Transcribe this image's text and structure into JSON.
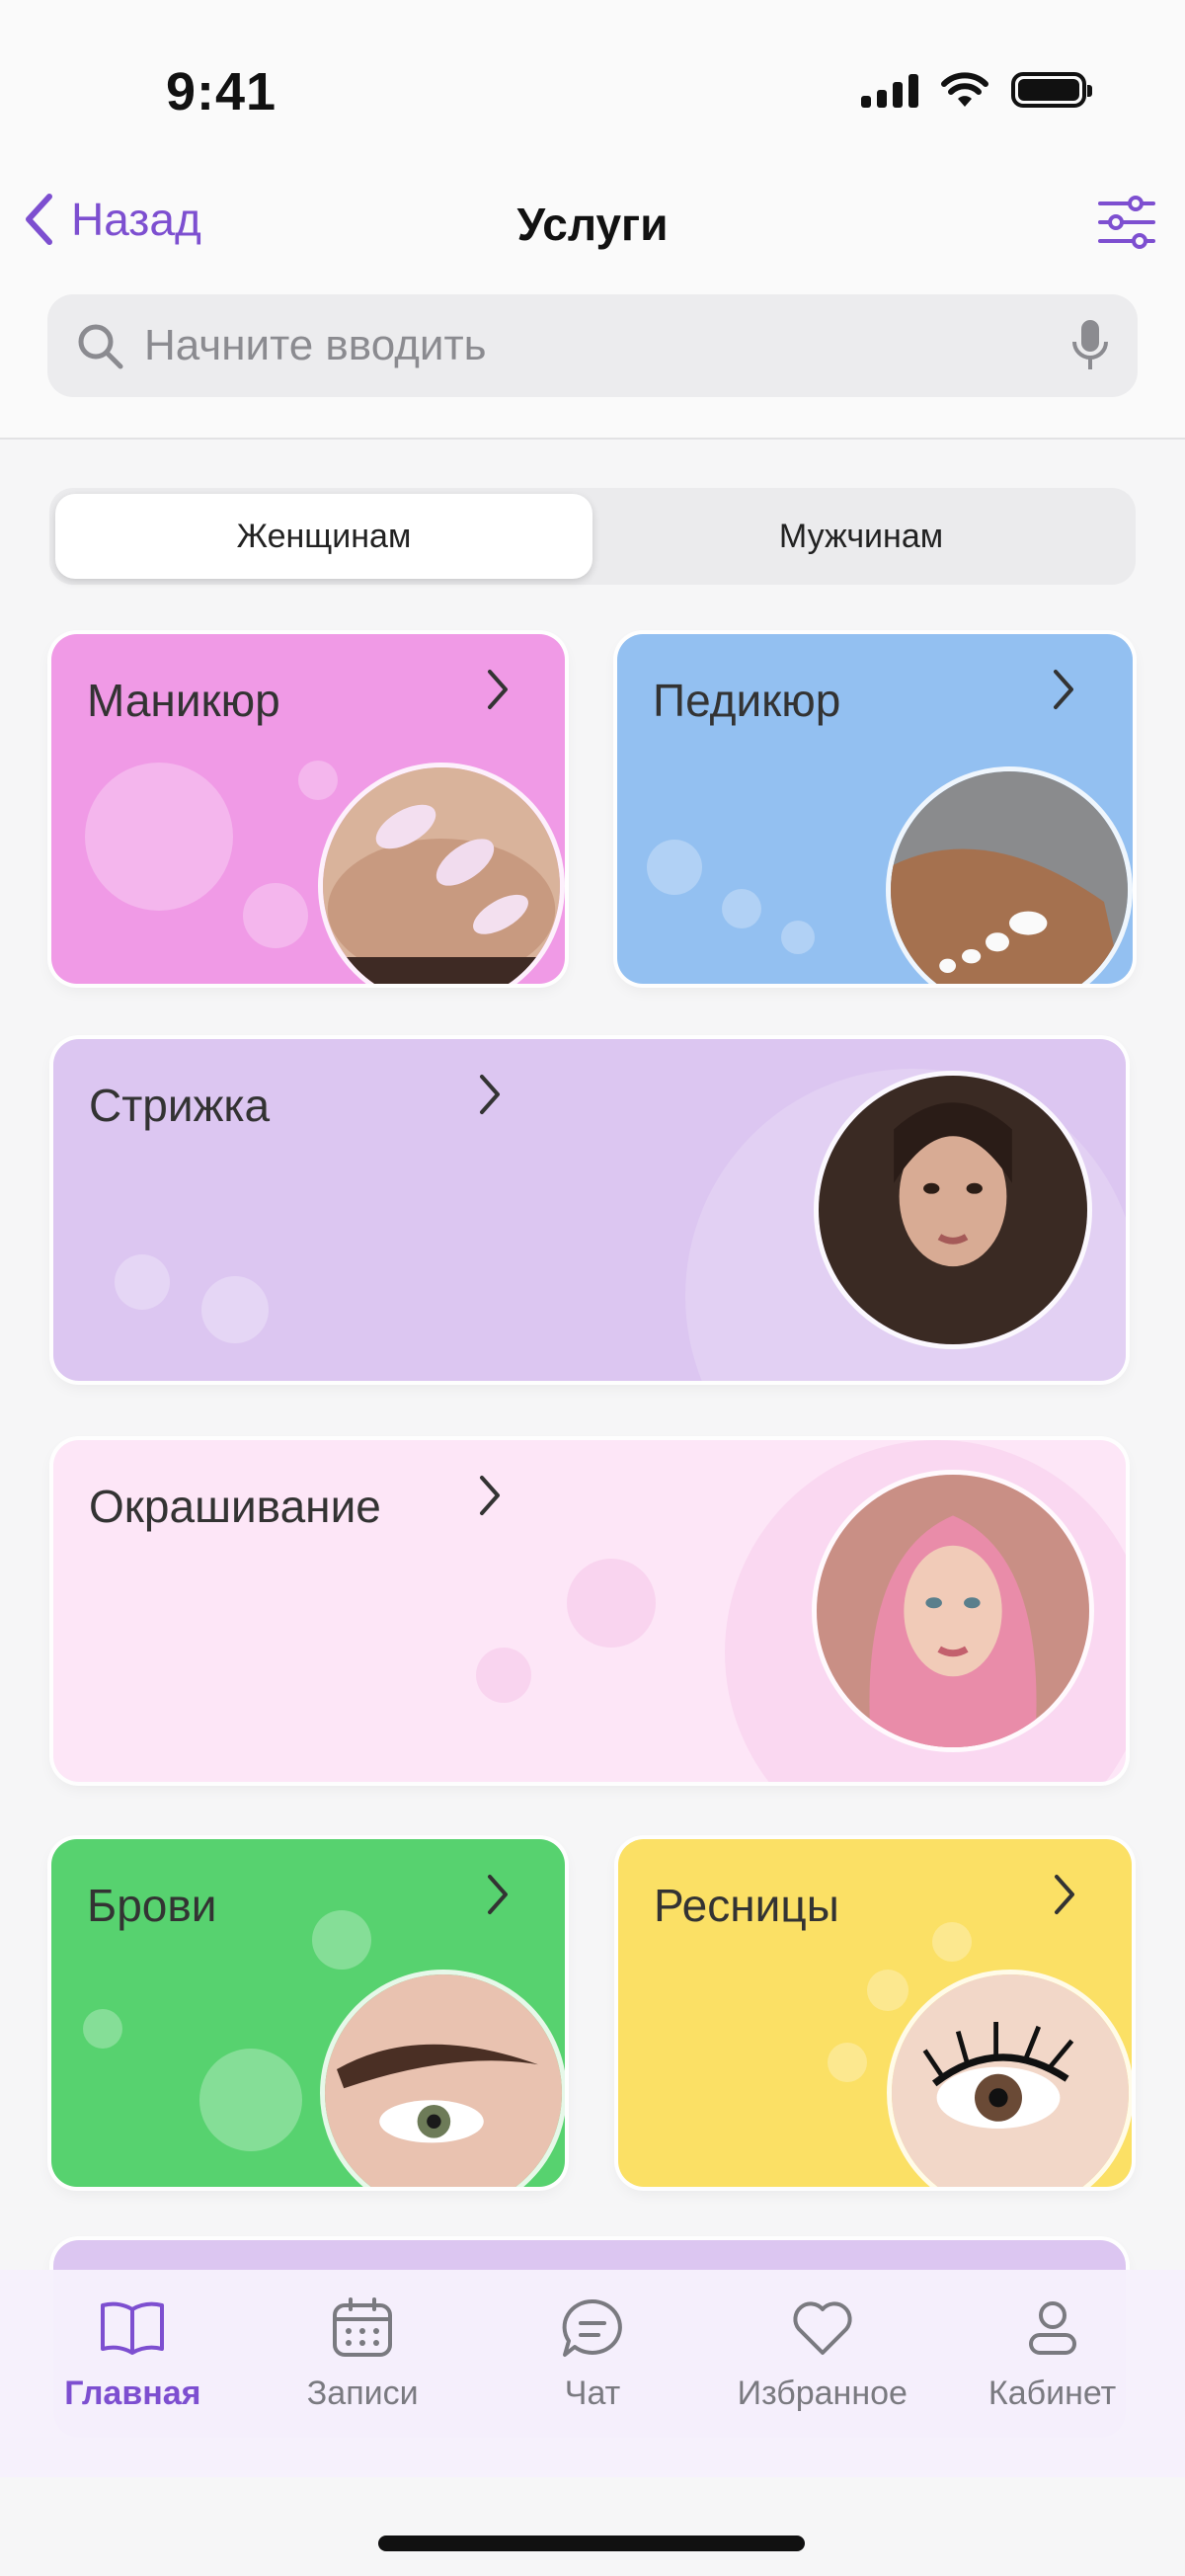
{
  "status_bar": {
    "time": "9:41"
  },
  "header": {
    "back_label": "Назад",
    "title": "Услуги",
    "search_placeholder": "Начните вводить"
  },
  "segments": [
    {
      "label": "Женщинам",
      "active": true
    },
    {
      "label": "Мужчинам",
      "active": false
    }
  ],
  "categories": [
    {
      "title": "Маникюр",
      "color": "#f09ae6",
      "image": "manicure-photo"
    },
    {
      "title": "Педикюр",
      "color": "#93c0f1",
      "image": "pedicure-photo"
    },
    {
      "title": "Стрижка",
      "color": "#dcc6f1",
      "image": "haircut-photo"
    },
    {
      "title": "Окрашивание",
      "color": "#fde6f7",
      "image": "hair-coloring-photo"
    },
    {
      "title": "Брови",
      "color": "#57d26f",
      "image": "brows-photo"
    },
    {
      "title": "Ресницы",
      "color": "#fbe065",
      "image": "lashes-photo"
    }
  ],
  "tab_bar": [
    {
      "label": "Главная",
      "icon": "book-icon",
      "active": true
    },
    {
      "label": "Записи",
      "icon": "calendar-icon",
      "active": false
    },
    {
      "label": "Чат",
      "icon": "chat-icon",
      "active": false
    },
    {
      "label": "Избранное",
      "icon": "heart-icon",
      "active": false
    },
    {
      "label": "Кабинет",
      "icon": "profile-icon",
      "active": false
    }
  ],
  "colors": {
    "accent": "#7d4fd0",
    "background": "#f6f6f7"
  }
}
